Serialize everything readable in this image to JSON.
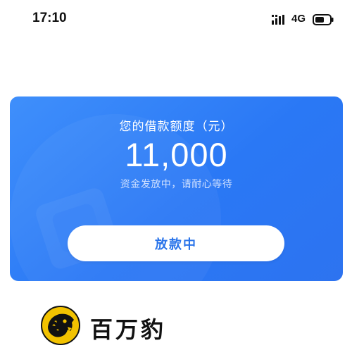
{
  "status_bar": {
    "time": "17:10",
    "network": "4G",
    "icons": [
      "signal-icon",
      "battery-icon"
    ]
  },
  "loan_card": {
    "label": "您的借款额度（元）",
    "amount": "11,000",
    "status": "资金发放中，请耐心等待",
    "button_label": "放款中"
  },
  "brand": {
    "name": "百万豹",
    "logo": "leopard-logo"
  },
  "colors": {
    "card_blue": "#2a78f5",
    "button_text": "#2a74ea",
    "brand_yellow": "#f2c200"
  }
}
